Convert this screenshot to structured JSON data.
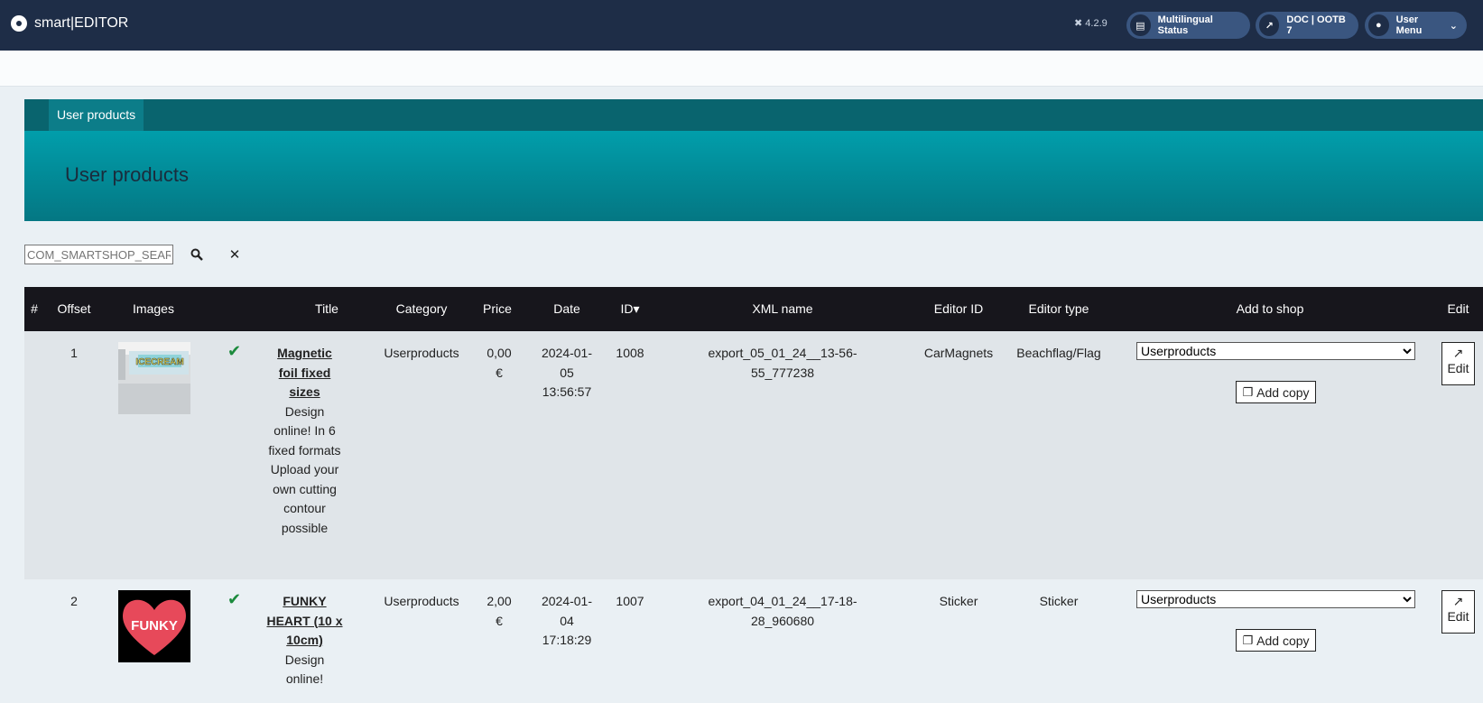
{
  "app": {
    "title": "smart|EDITOR",
    "version": "4.2.9"
  },
  "header_pills": {
    "multilingual": "Multilingual Status",
    "doc": "DOC | OOTB 7",
    "user_menu": "User Menu"
  },
  "breadcrumb_tab": "User products",
  "page_title": "User products",
  "search": {
    "placeholder": "COM_SMARTSHOP_SEARCH",
    "value": ""
  },
  "table": {
    "columns": [
      "#",
      "Offset",
      "Images",
      "Title",
      "Category",
      "Price",
      "Date",
      "ID▾",
      "XML name",
      "Editor ID",
      "Editor type",
      "Add to shop",
      "Edit"
    ],
    "rows": [
      {
        "offset": "1",
        "image": "ICECREAM",
        "title": "Magnetic foil fixed sizes",
        "description": "Design online! In 6 fixed formats Upload your own cutting contour possible",
        "category": "Userproducts",
        "price": "0,00 €",
        "date": "2024-01-05 13:56:57",
        "id": "1008",
        "xml_name": "export_05_01_24__13-56-55_777238",
        "editor_id": "CarMagnets",
        "editor_type": "Beachflag/Flag",
        "shop_select": "Userproducts",
        "add_copy": "Add copy",
        "edit": "Edit"
      },
      {
        "offset": "2",
        "image": "FUNKY",
        "title": "FUNKY HEART (10 x 10cm)",
        "description": "Design online!",
        "category": "Userproducts",
        "price": "2,00 €",
        "date": "2024-01-04 17:18:29",
        "id": "1007",
        "xml_name": "export_04_01_24__17-18-28_960680",
        "editor_id": "Sticker",
        "editor_type": "Sticker",
        "shop_select": "Userproducts",
        "add_copy": "Add copy",
        "edit": "Edit"
      }
    ]
  },
  "colors": {
    "topbar": "#1e2d47",
    "hero": "#019eab",
    "tabstrip": "#09646e",
    "thead": "#17161c",
    "check": "#1b8a3c"
  }
}
